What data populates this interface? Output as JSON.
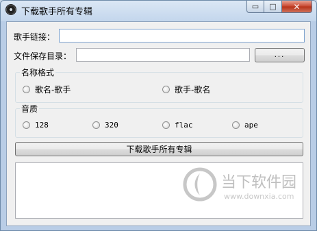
{
  "window": {
    "title": "下载歌手所有专辑",
    "minimize_glyph": "▭",
    "maximize_glyph": "□",
    "close_glyph": "✕"
  },
  "form": {
    "singer_link_label": "歌手链接：",
    "singer_link_value": "",
    "save_dir_label": "文件保存目录：",
    "save_dir_value": "",
    "browse_button_label": "..."
  },
  "name_format": {
    "title": "名称格式",
    "options": [
      {
        "label": "歌名-歌手",
        "selected": false
      },
      {
        "label": "歌手-歌名",
        "selected": false
      }
    ]
  },
  "quality": {
    "title": "音质",
    "options": [
      {
        "label": "128",
        "selected": false
      },
      {
        "label": "320",
        "selected": false
      },
      {
        "label": "flac",
        "selected": false
      },
      {
        "label": "ape",
        "selected": false
      }
    ]
  },
  "download_button_label": "下载歌手所有专辑",
  "output_log": "",
  "watermark": {
    "text": "当下软件园",
    "url": "www.downxia.com"
  }
}
